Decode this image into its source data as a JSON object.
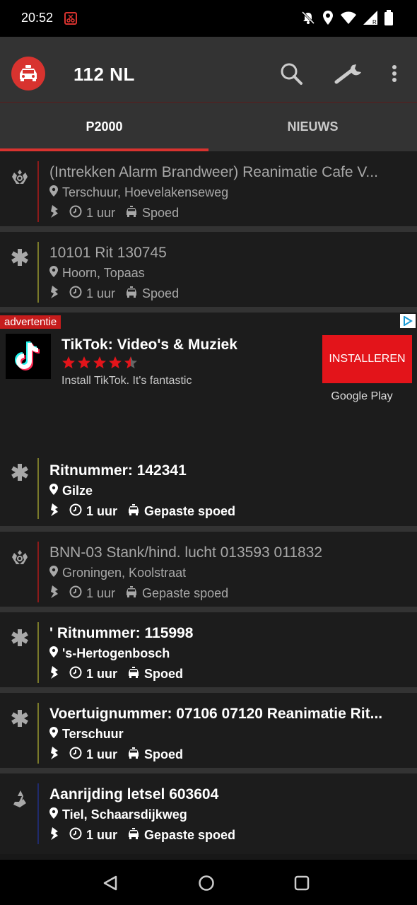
{
  "status_bar": {
    "time": "20:52",
    "icons": [
      "screenshot-notify-icon",
      "bell-off-icon",
      "location-icon",
      "wifi-icon",
      "signal-icon",
      "battery-icon"
    ]
  },
  "app_bar": {
    "title": "112 NL",
    "logo_icon": "emergency-car-icon",
    "actions": [
      "search-icon",
      "wrench-icon",
      "more-vert-icon"
    ]
  },
  "tabs": [
    {
      "label": "P2000",
      "active": true
    },
    {
      "label": "NIEUWS",
      "active": false
    }
  ],
  "colors": {
    "accent": "#d8332f",
    "fire": "#8b1a1a",
    "ambulance": "#7a7a2a",
    "police": "#1f2a6b",
    "ad_button": "#e3141a"
  },
  "items": [
    {
      "service": "brandweer",
      "icon": "fire-brigade-icon",
      "title": "(Intrekken Alarm Brandweer) Reanimatie Cafe V...",
      "location": "Terschuur, Hoevelakenseweg",
      "time": "1 uur",
      "urgency": "Spoed",
      "read": true
    },
    {
      "service": "ambulance",
      "icon": "star-of-life-icon",
      "title": "10101 Rit 130745",
      "location": "Hoorn, Topaas",
      "time": "1 uur",
      "urgency": "Spoed",
      "read": true
    }
  ],
  "ad": {
    "label": "advertentie",
    "app_name": "TikTok: Video's & Muziek",
    "rating": 4.5,
    "description": "Install TikTok. It's fantastic",
    "button": "INSTALLEREN",
    "store": "Google Play"
  },
  "items_after_ad": [
    {
      "service": "ambulance",
      "icon": "star-of-life-icon",
      "title": "Ritnummer: 142341",
      "location": "Gilze",
      "time": "1 uur",
      "urgency": "Gepaste spoed",
      "read": false
    },
    {
      "service": "brandweer",
      "icon": "fire-brigade-icon",
      "title": "BNN-03 Stank/hind. lucht 013593 011832",
      "location": "Groningen, Koolstraat",
      "time": "1 uur",
      "urgency": "Gepaste spoed",
      "read": true
    },
    {
      "service": "ambulance",
      "icon": "star-of-life-icon",
      "title": "' Ritnummer: 115998",
      "location": "'s-Hertogenbosch",
      "time": "1 uur",
      "urgency": "Spoed",
      "read": false
    },
    {
      "service": "ambulance",
      "icon": "star-of-life-icon",
      "title": "Voertuignummer: 07106 07120 Reanimatie Rit...",
      "location": "Terschuur",
      "time": "1 uur",
      "urgency": "Spoed",
      "read": false
    },
    {
      "service": "politie",
      "icon": "police-icon",
      "title": "Aanrijding letsel 603604",
      "location": "Tiel, Schaarsdijkweg",
      "time": "1 uur",
      "urgency": "Gepaste spoed",
      "read": false
    }
  ],
  "nav_bar": [
    "back-icon",
    "home-icon",
    "recents-icon"
  ]
}
